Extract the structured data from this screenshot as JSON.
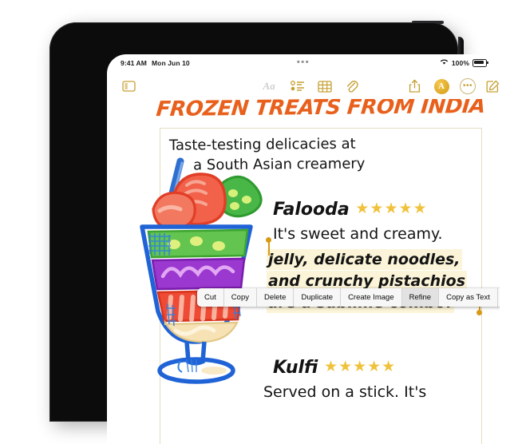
{
  "status_bar": {
    "time": "9:41 AM",
    "date": "Mon Jun 10",
    "multitask_indicator": "•••",
    "wifi_icon": "wifi-icon",
    "battery_percent": "100%",
    "battery_icon": "battery-full-icon"
  },
  "toolbar": {
    "sidebar_icon": "sidebar-toggle-icon",
    "format_label": "Aa",
    "checklist_icon": "checklist-icon",
    "table_icon": "table-icon",
    "attach_icon": "paperclip-icon",
    "share_icon": "share-icon",
    "intelligence_label": "A",
    "more_label": "•••",
    "compose_icon": "compose-icon"
  },
  "note": {
    "title": "FROZEN TREATS FROM INDIA",
    "subtitle_line1": "Taste-testing delicacies at",
    "subtitle_line2": "a South Asian creamery",
    "sections": [
      {
        "heading": "Falooda",
        "stars": "★★★★★",
        "star_count": 5,
        "line1": "It's sweet and creamy.",
        "highlighted_line1": "jelly, delicate noodles,",
        "highlighted_line2": "and crunchy pistachios",
        "highlighted_line3": "are a sublime combo!"
      },
      {
        "heading": "Kulfi",
        "stars": "★★★★★",
        "star_count": 5,
        "line1": "Served on a stick. It's"
      }
    ],
    "drawing_alt": "sundae-glass-drawing"
  },
  "context_menu": {
    "items": [
      {
        "label": "Cut",
        "active": false
      },
      {
        "label": "Copy",
        "active": false
      },
      {
        "label": "Delete",
        "active": false
      },
      {
        "label": "Duplicate",
        "active": false
      },
      {
        "label": "Create Image",
        "active": false
      },
      {
        "label": "Refine",
        "active": true
      },
      {
        "label": "Copy as Text",
        "active": false
      },
      {
        "label": "›",
        "active": false
      }
    ]
  },
  "colors": {
    "accent_gold": "#c6a033",
    "title_orange": "#e8601c",
    "star_yellow": "#f0c23c",
    "highlight": "#fbf4d8",
    "rule_line": "#e4dcc0",
    "selection_handle": "#d79a16"
  }
}
